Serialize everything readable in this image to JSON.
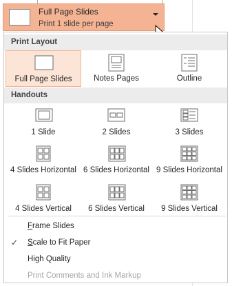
{
  "selector": {
    "title": "Full Page Slides",
    "subtitle": "Print 1 slide per page"
  },
  "print_layout": {
    "heading": "Print Layout",
    "items": [
      {
        "label": "Full Page Slides",
        "selected": true
      },
      {
        "label": "Notes Pages",
        "selected": false
      },
      {
        "label": "Outline",
        "selected": false
      }
    ]
  },
  "handouts": {
    "heading": "Handouts",
    "items": [
      {
        "label": "1 Slide"
      },
      {
        "label": "2 Slides"
      },
      {
        "label": "3 Slides"
      },
      {
        "label": "4 Slides Horizontal"
      },
      {
        "label": "6 Slides Horizontal"
      },
      {
        "label": "9 Slides Horizontal"
      },
      {
        "label": "4 Slides Vertical"
      },
      {
        "label": "6 Slides Vertical"
      },
      {
        "label": "9 Slides Vertical"
      }
    ]
  },
  "options": {
    "frame_slides": {
      "label_u": "F",
      "label_rest": "rame Slides",
      "checked": false
    },
    "scale_to_fit": {
      "label_u": "S",
      "label_rest": "cale to Fit Paper",
      "checked": true,
      "check_glyph": "✓"
    },
    "high_quality": {
      "label": "High Quality",
      "checked": false
    },
    "print_comments": {
      "label": "Print Comments and Ink Markup",
      "enabled": false
    }
  },
  "colors": {
    "accent": "#f4b393",
    "accent_border": "#e79a75",
    "selected_bg": "#fce4d6",
    "section_bg": "#ececec"
  }
}
